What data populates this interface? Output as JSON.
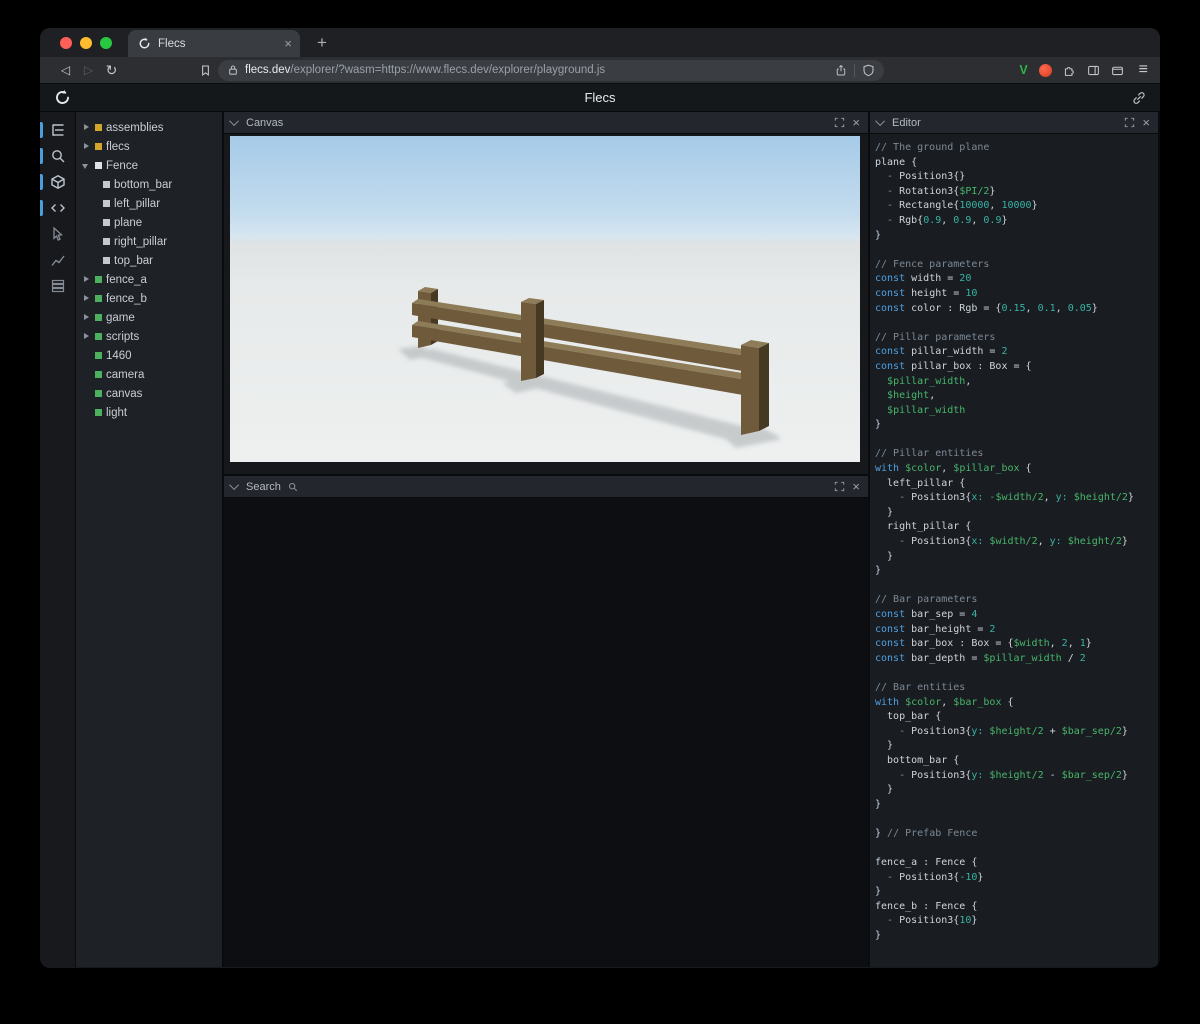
{
  "browser": {
    "tab_title": "Flecs",
    "tab_close": "×",
    "new_tab": "+",
    "glyphs": {
      "back": "◁",
      "forward": "▷",
      "reload": "↻",
      "menu": "≡"
    },
    "url_domain": "flecs.dev",
    "url_path": "/explorer/?wasm=https://www.flecs.dev/explorer/playground.js",
    "extensions": {
      "v_label": "V"
    }
  },
  "header": {
    "title": "Flecs"
  },
  "panels": {
    "canvas": {
      "title": "Canvas"
    },
    "search": {
      "title": "Search"
    },
    "editor": {
      "title": "Editor"
    },
    "close_glyph": "×"
  },
  "rail": {
    "items": [
      {
        "name": "tree",
        "active": true
      },
      {
        "name": "search",
        "active": true
      },
      {
        "name": "scene",
        "active": true
      },
      {
        "name": "code",
        "active": true
      },
      {
        "name": "inspector",
        "active": false
      },
      {
        "name": "stats",
        "active": false
      },
      {
        "name": "memory",
        "active": false
      }
    ]
  },
  "tree": {
    "items": [
      {
        "label": "assemblies",
        "depth": 0,
        "state": "closed",
        "kind": "module"
      },
      {
        "label": "flecs",
        "depth": 0,
        "state": "closed",
        "kind": "module"
      },
      {
        "label": "Fence",
        "depth": 0,
        "state": "open",
        "kind": "prefab"
      },
      {
        "label": "bottom_bar",
        "depth": 1,
        "state": "leaf",
        "kind": "child"
      },
      {
        "label": "left_pillar",
        "depth": 1,
        "state": "leaf",
        "kind": "child"
      },
      {
        "label": "plane",
        "depth": 1,
        "state": "leaf",
        "kind": "child"
      },
      {
        "label": "right_pillar",
        "depth": 1,
        "state": "leaf",
        "kind": "child"
      },
      {
        "label": "top_bar",
        "depth": 1,
        "state": "leaf",
        "kind": "child"
      },
      {
        "label": "fence_a",
        "depth": 0,
        "state": "closed",
        "kind": "entity"
      },
      {
        "label": "fence_b",
        "depth": 0,
        "state": "closed",
        "kind": "entity"
      },
      {
        "label": "game",
        "depth": 0,
        "state": "closed",
        "kind": "entity"
      },
      {
        "label": "scripts",
        "depth": 0,
        "state": "closed",
        "kind": "entity"
      },
      {
        "label": "1460",
        "depth": 0,
        "state": "leaf",
        "kind": "entity"
      },
      {
        "label": "camera",
        "depth": 0,
        "state": "leaf",
        "kind": "entity"
      },
      {
        "label": "canvas",
        "depth": 0,
        "state": "leaf",
        "kind": "entity"
      },
      {
        "label": "light",
        "depth": 0,
        "state": "leaf",
        "kind": "entity"
      }
    ]
  },
  "editor": {
    "code_lines": [
      [
        [
          "cm",
          "// The ground plane"
        ]
      ],
      [
        [
          "tx",
          "plane {"
        ]
      ],
      [
        [
          "pn",
          "  - "
        ],
        [
          "tx",
          "Position3{}"
        ]
      ],
      [
        [
          "pn",
          "  - "
        ],
        [
          "tx",
          "Rotation3{"
        ],
        [
          "vr",
          "$PI/2"
        ],
        [
          "tx",
          "}"
        ]
      ],
      [
        [
          "pn",
          "  - "
        ],
        [
          "tx",
          "Rectangle{"
        ],
        [
          "nm",
          "10000"
        ],
        [
          "tx",
          ", "
        ],
        [
          "nm",
          "10000"
        ],
        [
          "tx",
          "}"
        ]
      ],
      [
        [
          "pn",
          "  - "
        ],
        [
          "tx",
          "Rgb{"
        ],
        [
          "nm",
          "0.9"
        ],
        [
          "tx",
          ", "
        ],
        [
          "nm",
          "0.9"
        ],
        [
          "tx",
          ", "
        ],
        [
          "nm",
          "0.9"
        ],
        [
          "tx",
          "}"
        ]
      ],
      [
        [
          "tx",
          "}"
        ]
      ],
      [],
      [
        [
          "cm",
          "// Fence parameters"
        ]
      ],
      [
        [
          "kw",
          "const"
        ],
        [
          "tx",
          " width = "
        ],
        [
          "nm",
          "20"
        ]
      ],
      [
        [
          "kw",
          "const"
        ],
        [
          "tx",
          " height = "
        ],
        [
          "nm",
          "10"
        ]
      ],
      [
        [
          "kw",
          "const"
        ],
        [
          "tx",
          " color : Rgb = {"
        ],
        [
          "nm",
          "0.15"
        ],
        [
          "tx",
          ", "
        ],
        [
          "nm",
          "0.1"
        ],
        [
          "tx",
          ", "
        ],
        [
          "nm",
          "0.05"
        ],
        [
          "tx",
          "}"
        ]
      ],
      [],
      [
        [
          "cm",
          "// Pillar parameters"
        ]
      ],
      [
        [
          "kw",
          "const"
        ],
        [
          "tx",
          " pillar_width = "
        ],
        [
          "nm",
          "2"
        ]
      ],
      [
        [
          "kw",
          "const"
        ],
        [
          "tx",
          " pillar_box : Box = {"
        ]
      ],
      [
        [
          "tx",
          "  "
        ],
        [
          "vr",
          "$pillar_width"
        ],
        [
          "tx",
          ","
        ]
      ],
      [
        [
          "tx",
          "  "
        ],
        [
          "vr",
          "$height"
        ],
        [
          "tx",
          ","
        ]
      ],
      [
        [
          "tx",
          "  "
        ],
        [
          "vr",
          "$pillar_width"
        ]
      ],
      [
        [
          "tx",
          "}"
        ]
      ],
      [],
      [
        [
          "cm",
          "// Pillar entities"
        ]
      ],
      [
        [
          "kw",
          "with"
        ],
        [
          "tx",
          " "
        ],
        [
          "vr",
          "$color"
        ],
        [
          "tx",
          ", "
        ],
        [
          "vr",
          "$pillar_box"
        ],
        [
          "tx",
          " {"
        ]
      ],
      [
        [
          "tx",
          "  left_pillar {"
        ]
      ],
      [
        [
          "pn",
          "    - "
        ],
        [
          "tx",
          "Position3{"
        ],
        [
          "nm",
          "x:"
        ],
        [
          "tx",
          " "
        ],
        [
          "vr",
          "-$width/2"
        ],
        [
          "tx",
          ", "
        ],
        [
          "nm",
          "y:"
        ],
        [
          "tx",
          " "
        ],
        [
          "vr",
          "$height/2"
        ],
        [
          "tx",
          "}"
        ]
      ],
      [
        [
          "tx",
          "  }"
        ]
      ],
      [
        [
          "tx",
          "  right_pillar {"
        ]
      ],
      [
        [
          "pn",
          "    - "
        ],
        [
          "tx",
          "Position3{"
        ],
        [
          "nm",
          "x:"
        ],
        [
          "tx",
          " "
        ],
        [
          "vr",
          "$width/2"
        ],
        [
          "tx",
          ", "
        ],
        [
          "nm",
          "y:"
        ],
        [
          "tx",
          " "
        ],
        [
          "vr",
          "$height/2"
        ],
        [
          "tx",
          "}"
        ]
      ],
      [
        [
          "tx",
          "  }"
        ]
      ],
      [
        [
          "tx",
          "}"
        ]
      ],
      [],
      [
        [
          "cm",
          "// Bar parameters"
        ]
      ],
      [
        [
          "kw",
          "const"
        ],
        [
          "tx",
          " bar_sep = "
        ],
        [
          "nm",
          "4"
        ]
      ],
      [
        [
          "kw",
          "const"
        ],
        [
          "tx",
          " bar_height = "
        ],
        [
          "nm",
          "2"
        ]
      ],
      [
        [
          "kw",
          "const"
        ],
        [
          "tx",
          " bar_box : Box = {"
        ],
        [
          "vr",
          "$width"
        ],
        [
          "tx",
          ", "
        ],
        [
          "nm",
          "2"
        ],
        [
          "tx",
          ", "
        ],
        [
          "nm",
          "1"
        ],
        [
          "tx",
          "}"
        ]
      ],
      [
        [
          "kw",
          "const"
        ],
        [
          "tx",
          " bar_depth = "
        ],
        [
          "vr",
          "$pillar_width"
        ],
        [
          "tx",
          " / "
        ],
        [
          "nm",
          "2"
        ]
      ],
      [],
      [
        [
          "cm",
          "// Bar entities"
        ]
      ],
      [
        [
          "kw",
          "with"
        ],
        [
          "tx",
          " "
        ],
        [
          "vr",
          "$color"
        ],
        [
          "tx",
          ", "
        ],
        [
          "vr",
          "$bar_box"
        ],
        [
          "tx",
          " {"
        ]
      ],
      [
        [
          "tx",
          "  top_bar {"
        ]
      ],
      [
        [
          "pn",
          "    - "
        ],
        [
          "tx",
          "Position3{"
        ],
        [
          "nm",
          "y:"
        ],
        [
          "tx",
          " "
        ],
        [
          "vr",
          "$height/2"
        ],
        [
          "tx",
          " + "
        ],
        [
          "vr",
          "$bar_sep/2"
        ],
        [
          "tx",
          "}"
        ]
      ],
      [
        [
          "tx",
          "  }"
        ]
      ],
      [
        [
          "tx",
          "  bottom_bar {"
        ]
      ],
      [
        [
          "pn",
          "    - "
        ],
        [
          "tx",
          "Position3{"
        ],
        [
          "nm",
          "y:"
        ],
        [
          "tx",
          " "
        ],
        [
          "vr",
          "$height/2"
        ],
        [
          "tx",
          " - "
        ],
        [
          "vr",
          "$bar_sep/2"
        ],
        [
          "tx",
          "}"
        ]
      ],
      [
        [
          "tx",
          "  }"
        ]
      ],
      [
        [
          "tx",
          "}"
        ]
      ],
      [],
      [
        [
          "tx",
          "} "
        ],
        [
          "cm",
          "// Prefab Fence"
        ]
      ],
      [],
      [
        [
          "tx",
          "fence_a : Fence {"
        ]
      ],
      [
        [
          "pn",
          "  - "
        ],
        [
          "tx",
          "Position3{"
        ],
        [
          "nm",
          "-10"
        ],
        [
          "tx",
          "}"
        ]
      ],
      [
        [
          "tx",
          "}"
        ]
      ],
      [
        [
          "tx",
          "fence_b : Fence {"
        ]
      ],
      [
        [
          "pn",
          "  - "
        ],
        [
          "tx",
          "Position3{"
        ],
        [
          "nm",
          "10"
        ],
        [
          "tx",
          "}"
        ]
      ],
      [
        [
          "tx",
          "}"
        ]
      ]
    ]
  },
  "colors": {
    "accent": "#4a9eda",
    "traffic_red": "#ff5f57",
    "traffic_yellow": "#febc2e",
    "traffic_green": "#28c840",
    "module": "#d2a62c",
    "entity": "#4cb05e",
    "prefab": "#dfe3e8",
    "child": "#c3c9cf",
    "sky_top": "#a6cbe8",
    "sky_bottom": "#d7e6f0",
    "ground": "#e7eaea",
    "fence_top": "#8e7c59",
    "fence_front": "#6f5b3c",
    "fence_side": "#463924",
    "shadow": "#a9aeb1",
    "code_text": "#ced4da",
    "code_comment": "#7d8894",
    "code_keyword": "#4f9fe0",
    "code_variable": "#48b56a",
    "code_number": "#38b2a3"
  }
}
